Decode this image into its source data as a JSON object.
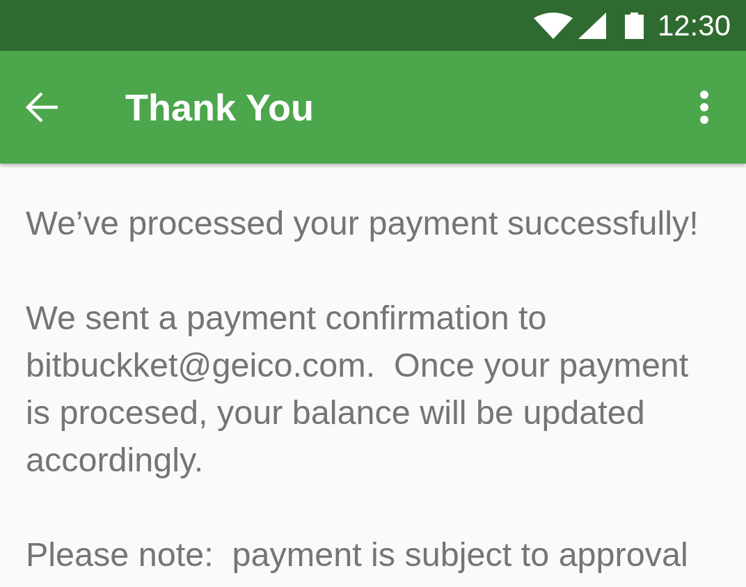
{
  "status_bar": {
    "time": "12:30"
  },
  "app_bar": {
    "title": "Thank You"
  },
  "content": {
    "paragraphs": [
      "We’ve processed your payment successfully!",
      "We sent a payment confirmation to bitbuckket@geico.com.  Once your payment is procesed, your balance will be updated accordingly.",
      "Please note:  payment is subject to approval"
    ]
  }
}
